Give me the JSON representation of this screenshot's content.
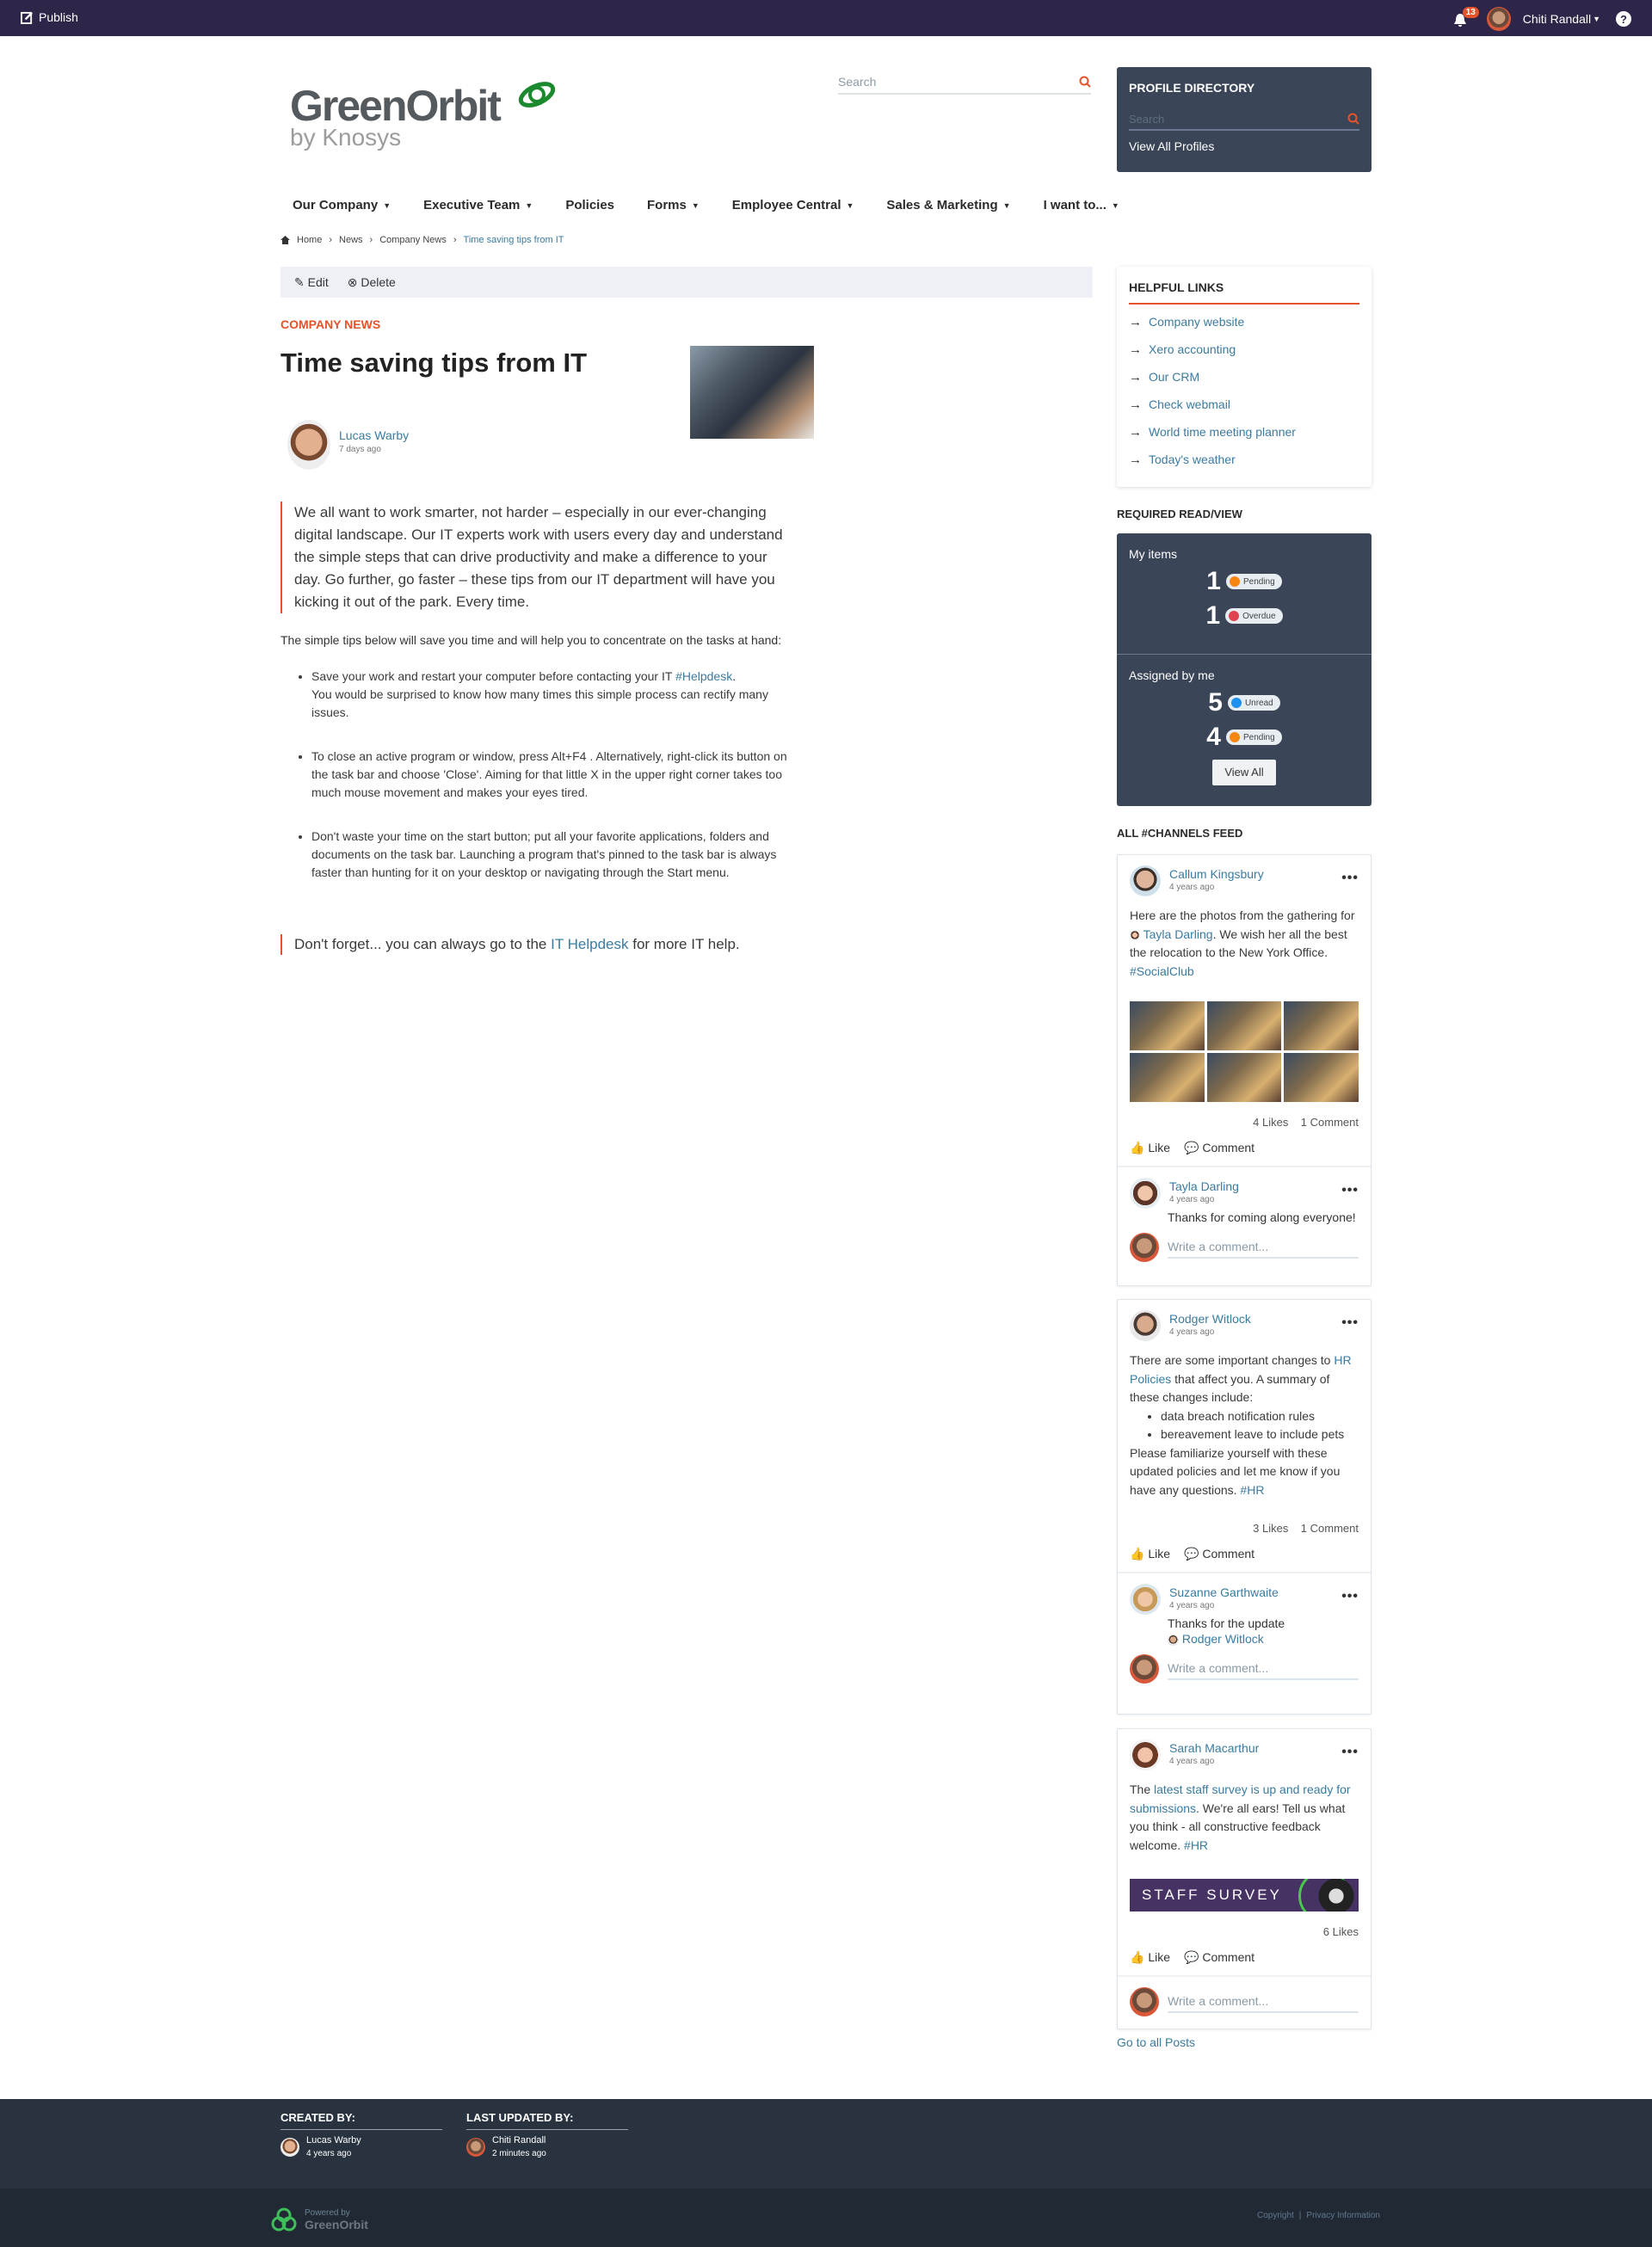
{
  "topbar": {
    "publish_label": "Publish",
    "notification_count": "13",
    "user_name": "Chiti Randall",
    "help_label": "?"
  },
  "brand": {
    "logo_main": "GreenOrbit",
    "logo_sub": "by Knosys",
    "accent": "#e4532a",
    "topbar_color": "#2e2548",
    "panel_color": "#3a4558"
  },
  "search": {
    "placeholder": "Search"
  },
  "nav": {
    "items": [
      {
        "label": "Our Company",
        "dropdown": true
      },
      {
        "label": "Executive Team",
        "dropdown": true
      },
      {
        "label": "Policies",
        "dropdown": false
      },
      {
        "label": "Forms",
        "dropdown": true
      },
      {
        "label": "Employee Central",
        "dropdown": true
      },
      {
        "label": "Sales & Marketing",
        "dropdown": true
      },
      {
        "label": "I want to...",
        "dropdown": true
      }
    ]
  },
  "breadcrumb": [
    "Home",
    "News",
    "Company News",
    "Time saving tips from IT"
  ],
  "editbar": {
    "edit_label": "Edit",
    "delete_label": "Delete"
  },
  "article": {
    "category": "COMPANY NEWS",
    "title": "Time saving tips from IT",
    "author": "Lucas Warby",
    "time": "7 days ago",
    "lead": "We all want to work smarter, not harder – especially in our ever-changing digital landscape. Our IT experts work with users every day and understand the simple steps that can drive productivity and make a difference to your day. Go further, go faster – these tips from our IT department will have you kicking it out of the park. Every time.",
    "intro": "The simple tips below will save you time and will help you to concentrate on the tasks at hand:",
    "tips": [
      {
        "pre": "Save your work and restart your computer before contacting your IT ",
        "link": "#Helpdesk",
        "post": ".",
        "line2": "You would be surprised to know how many times this simple process can rectify many issues."
      },
      {
        "pre": "To close an active program or window, press Alt+F4 . Alternatively, right-click its button on the task bar and choose 'Close'. Aiming for that little X in the upper right corner takes too much mouse movement and makes your eyes tired.",
        "link": "",
        "post": "",
        "line2": ""
      },
      {
        "pre": "Don't waste your time on the start button; put all your favorite applications, folders and documents on the task bar. Launching a program that's pinned to the task bar is always faster than hunting for it on your desktop or navigating through the Start menu.",
        "link": "",
        "post": "",
        "line2": ""
      }
    ],
    "closing_pre": "Don't forget... you can always go to the ",
    "closing_link": "IT Helpdesk",
    "closing_post": " for more IT help."
  },
  "profile_directory": {
    "title": "PROFILE DIRECTORY",
    "search_placeholder": "Search",
    "view_all": "View All Profiles"
  },
  "helpful_links": {
    "title": "HELPFUL LINKS",
    "items": [
      "Company website",
      "Xero accounting",
      "Our CRM",
      "Check webmail",
      "World time meeting planner",
      "Today's weather"
    ]
  },
  "required_read": {
    "title": "REQUIRED READ/VIEW",
    "my_items_label": "My items",
    "my_items": [
      {
        "count": "1",
        "status": "Pending",
        "color": "#f7860f"
      },
      {
        "count": "1",
        "status": "Overdue",
        "color": "#e0434f"
      }
    ],
    "assigned_label": "Assigned by me",
    "assigned": [
      {
        "count": "5",
        "status": "Unread",
        "color": "#1e90f0"
      },
      {
        "count": "4",
        "status": "Pending",
        "color": "#f7860f"
      }
    ],
    "view_all": "View All"
  },
  "feed": {
    "title": "ALL #CHANNELS FEED",
    "posts": [
      {
        "author": "Callum Kingsbury",
        "time": "4 years ago",
        "text_pre": "Here are the photos from the gathering for ",
        "mention": "Tayla Darling",
        "text_post": ". We wish her all the best the relocation to the New York Office. ",
        "hashtag": "#SocialClub",
        "likes": "4 Likes",
        "comments": "1 Comment",
        "comment": {
          "author": "Tayla Darling",
          "time": "4 years ago",
          "text": "Thanks for coming along everyone!"
        }
      },
      {
        "author": "Rodger Witlock",
        "time": "4 years ago",
        "text_pre": "There are some important changes to ",
        "link": "HR Policies",
        "text_mid": " that affect you. A summary of these changes include:",
        "bullets": [
          "data breach notification rules",
          "bereavement leave to include pets"
        ],
        "text_post": "Please familiarize yourself with these updated policies and let me know if you have any questions. ",
        "hashtag": "#HR",
        "likes": "3 Likes",
        "comments": "1 Comment",
        "comment": {
          "author": "Suzanne Garthwaite",
          "time": "4 years ago",
          "text": "Thanks for the update",
          "mention": "Rodger Witlock"
        }
      },
      {
        "author": "Sarah Macarthur",
        "time": "4 years ago",
        "text_pre": "The ",
        "link": "latest staff survey is up and ready for submissions",
        "text_post": ". We're all ears! Tell us what you think - all constructive feedback welcome. ",
        "hashtag": "#HR",
        "banner": "STAFF SURVEY",
        "likes": "6 Likes"
      }
    ],
    "like_label": "Like",
    "comment_label": "Comment",
    "write_placeholder": "Write a comment...",
    "go_all": "Go to all Posts"
  },
  "footer": {
    "created_label": "CREATED BY:",
    "created_name": "Lucas Warby",
    "created_time": "4 years ago",
    "updated_label": "LAST UPDATED BY:",
    "updated_name": "Chiti Randall",
    "updated_time": "2 minutes ago",
    "powered_by": "Powered by",
    "powered_brand": "GreenOrbit",
    "copyright": "Copyright",
    "sep": "|",
    "privacy": "Privacy Information"
  }
}
